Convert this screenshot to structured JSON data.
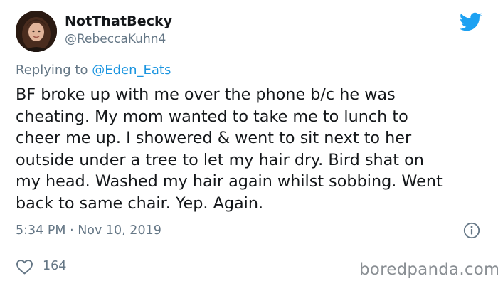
{
  "author": {
    "display_name": "NotThatBecky",
    "handle": "@RebeccaKuhn4"
  },
  "reply": {
    "prefix": "Replying to ",
    "mention": "@Eden_Eats"
  },
  "tweet": {
    "text": "BF broke up with me over the phone  b/c he was\ncheating. My mom wanted to take me to lunch to\ncheer me up. I showered & went to sit next to her\noutside under a tree to let my hair dry. Bird shat on\nmy head. Washed my hair again whilst sobbing. Went\nback to same chair. Yep. Again.",
    "timestamp": "5:34 PM · Nov 10, 2019",
    "like_count": "164"
  },
  "icons": {
    "brand": "twitter-bird-icon",
    "info": "info-icon",
    "like": "heart-icon"
  },
  "colors": {
    "twitter_blue": "#1da1f2",
    "link_blue": "#1b95e0",
    "secondary_text": "#657786",
    "primary_text": "#14171a",
    "divider": "#e1e8ed"
  },
  "watermark": {
    "text": "boredpanda.com"
  }
}
